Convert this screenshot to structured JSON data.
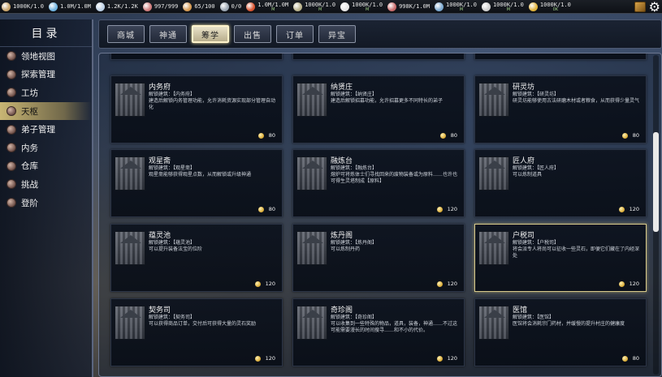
{
  "resources": [
    {
      "icon": "wood-icon",
      "value": "1000K/1.0",
      "color": "#c9a46a"
    },
    {
      "icon": "water-drop-icon",
      "value": "1.0M/1.0M",
      "color": "#6fb3e0"
    },
    {
      "icon": "ore-icon",
      "value": "1.2K/1.2K",
      "color": "#bcd0e6"
    },
    {
      "icon": "population-icon",
      "value": "997/999",
      "color": "#d07c7c"
    },
    {
      "icon": "disciple-icon",
      "value": "65/100",
      "color": "#d69a52"
    },
    {
      "icon": "bowl-icon",
      "value": "0/0",
      "color": "#9aa5b1"
    },
    {
      "icon": "fire-icon",
      "value": "1.0M/1.0M",
      "sub": "M",
      "color": "#d9532f"
    },
    {
      "icon": "scroll-icon",
      "value": "1000K/1.0",
      "sub": "M",
      "color": "#b7b08a"
    },
    {
      "icon": "silk-icon",
      "value": "1000K/1.0",
      "sub": "M",
      "color": "#e6e6e6"
    },
    {
      "icon": "meat-icon",
      "value": "998K/1.0M",
      "color": "#c86a6a"
    },
    {
      "icon": "fish-icon",
      "value": "1000K/1.0",
      "sub": "M",
      "color": "#7aa7cf"
    },
    {
      "icon": "compass-icon",
      "value": "1000K/1.0",
      "sub": "M",
      "color": "#cfcfcf"
    },
    {
      "icon": "gold-coin-icon",
      "value": "1000K/1.0",
      "sub": "0K",
      "color": "#e0b23a"
    }
  ],
  "sidebar": {
    "title": "目录",
    "items": [
      {
        "label": "领地视图",
        "active": false
      },
      {
        "label": "探索管理",
        "active": false
      },
      {
        "label": "工坊",
        "active": false
      },
      {
        "label": "天枢",
        "active": true
      },
      {
        "label": "弟子管理",
        "active": false
      },
      {
        "label": "内务",
        "active": false
      },
      {
        "label": "仓库",
        "active": false
      },
      {
        "label": "挑战",
        "active": false
      },
      {
        "label": "登阶",
        "active": false
      }
    ]
  },
  "tabs": [
    {
      "label": "商城",
      "active": false
    },
    {
      "label": "神通",
      "active": false
    },
    {
      "label": "筹学",
      "active": true
    },
    {
      "label": "出售",
      "active": false
    },
    {
      "label": "订单",
      "active": false
    },
    {
      "label": "异宝",
      "active": false
    }
  ],
  "cards": [
    {
      "name": "内务府",
      "unlock": "解锁建筑：【内务府】",
      "desc": "建造后解锁内务管理功能，允许消耗资源实现部分管理自动化",
      "cost": "80",
      "highlight": false
    },
    {
      "name": "纳贤庄",
      "unlock": "解锁建筑：【纳贤庄】",
      "desc": "建造后解锁招募功能，允许招募更多不同特长的弟子",
      "cost": "80",
      "highlight": false
    },
    {
      "name": "研灵坊",
      "unlock": "解锁建筑：【研灵坊】",
      "desc": "研灵坊能够使用古法研磨木材或者粮食，从而获得少量灵气",
      "cost": "80",
      "highlight": false
    },
    {
      "name": "观星斋",
      "unlock": "解锁建筑：【观星斋】",
      "desc": "观星斋能够获得观星点数，从而解锁或升级神通",
      "cost": "80",
      "highlight": false
    },
    {
      "name": "融炼台",
      "unlock": "解锁建筑：【融炼台】",
      "desc": "熔炉可将炼体士们寻找回来的废物装备或为原料……也许也可得生灵塔制成【原料】",
      "cost": "120",
      "highlight": false
    },
    {
      "name": "匠人府",
      "unlock": "解锁建筑：【匠人府】",
      "desc": "可以炼制道具",
      "cost": "120",
      "highlight": false
    },
    {
      "name": "蕴灵池",
      "unlock": "解锁建筑：【蕴灵池】",
      "desc": "可以提升装备法宝的位阶",
      "cost": "120",
      "highlight": false
    },
    {
      "name": "炼丹阁",
      "unlock": "解锁建筑：【炼丹阁】",
      "desc": "可以炼制丹药",
      "cost": "120",
      "highlight": false
    },
    {
      "name": "户税司",
      "unlock": "解锁建筑：【户税司】",
      "desc": "将会派专人将尚可以征收一些灵石，即便它们藏在了内经深处",
      "cost": "120",
      "highlight": true
    },
    {
      "name": "契务司",
      "unlock": "解锁建筑：【契务司】",
      "desc": "可以获得商品订单，交付后可获得大量的灵石奖励",
      "cost": "120",
      "highlight": false
    },
    {
      "name": "奇珍阁",
      "unlock": "解锁建筑：【奇珍阁】",
      "desc": "可以收集到一些特殊的物品，道具，装备，神通……不过这可能需要漫长的时间搜寻……和不小的代价。",
      "cost": "120",
      "highlight": false
    },
    {
      "name": "医馆",
      "unlock": "解锁建筑：【医馆】",
      "desc": "医馆将会消耗宗门药材，并缓慢的提升村庄的健康度",
      "cost": "80",
      "highlight": false
    }
  ]
}
